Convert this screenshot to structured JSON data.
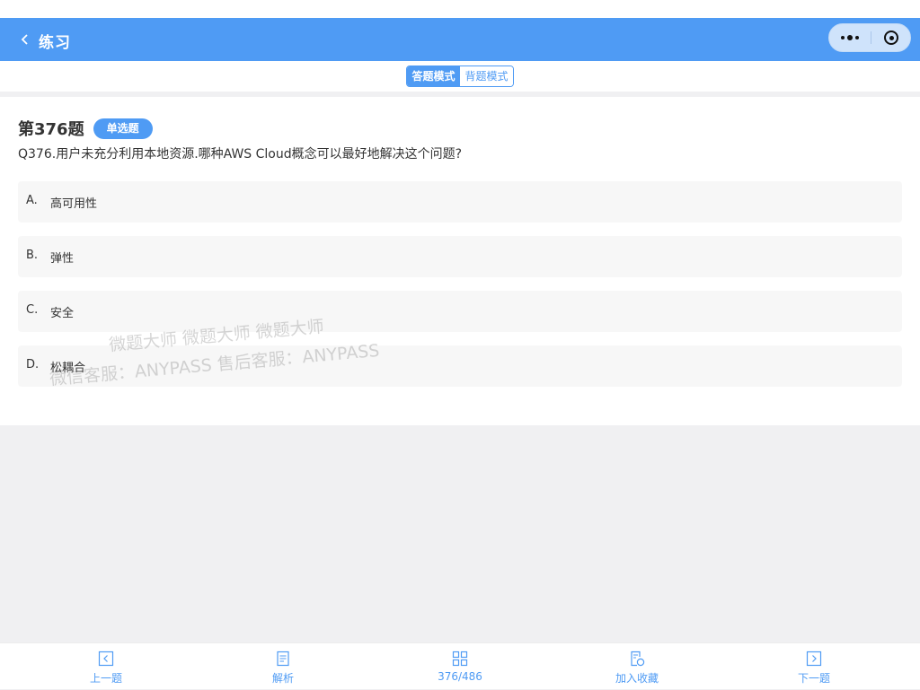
{
  "nav": {
    "title": "练习"
  },
  "mode": {
    "answer_label": "答题模式",
    "recite_label": "背题模式",
    "active": "answer"
  },
  "question": {
    "number": "第376题",
    "type": "单选题",
    "text": "Q376.用户未充分利用本地资源.哪种AWS Cloud概念可以最好地解决这个问题?"
  },
  "options": [
    {
      "letter": "A.",
      "text": "高可用性"
    },
    {
      "letter": "B.",
      "text": "弹性"
    },
    {
      "letter": "C.",
      "text": "安全"
    },
    {
      "letter": "D.",
      "text": "松耦合"
    }
  ],
  "watermark": {
    "line1": "微题大师 微题大师 微题大师",
    "line2": "微信客服：ANYPASS 售后客服：ANYPASS"
  },
  "tabbar": {
    "prev": {
      "label": "上一题",
      "icon": "chevron-left-box-icon"
    },
    "analysis": {
      "label": "解析",
      "icon": "document-icon"
    },
    "progress": {
      "label": "376/486",
      "icon": "grid-icon"
    },
    "favorite": {
      "label": "加入收藏",
      "icon": "favorite-doc-icon"
    },
    "next": {
      "label": "下一题",
      "icon": "chevron-right-box-icon"
    }
  },
  "colors": {
    "primary": "#4f9bf4",
    "background": "#f0f0f2",
    "option_bg": "#f7f7f7"
  }
}
